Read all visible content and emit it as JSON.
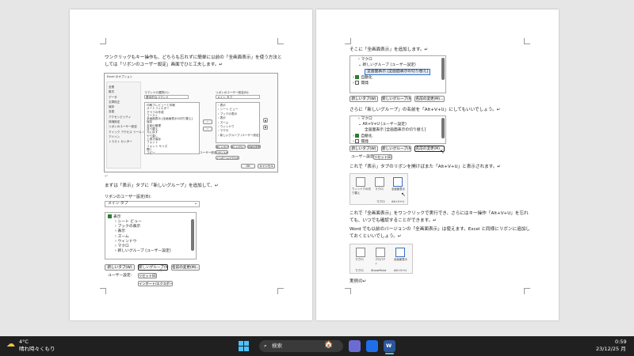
{
  "left_page": {
    "para1": "ワンクリックもキー操作も、どちらも忘れずに簡単に以前の「全画面表示」を使う方法と",
    "para1b": "しては「リボンのユーザー設定」画面でひと工夫します。↵",
    "dialog": {
      "title": "Excel のオプション",
      "categories": [
        "全般",
        "数式",
        "データ",
        "文章校正",
        "保存",
        "言語",
        "アクセシビリティ",
        "詳細設定",
        "リボンのユーザー設定",
        "クイック アクセス ツール バー",
        "アドイン",
        "トラスト センター"
      ],
      "commands_label": "コマンドの選択(C):",
      "commands_value": "基本的なコマンド",
      "ribbon_label": "リボンのユーザー設定(B):",
      "ribbon_value": "メイン タブ",
      "command_items": [
        "印刷プレビューと印刷",
        "オートフィルター",
        "グラフの作成",
        "ゴースト",
        "全画面表示 [全画面表示の切り替え]",
        "保存",
        "名前の管理",
        "並べ替え",
        "元に戻す",
        "やり直し",
        "上書き保存",
        "フォント",
        "フォント サイズ",
        "開く",
        "コピー"
      ],
      "tree_items": [
        "表示",
        "シート ビュー",
        "ブックの表示",
        "表示",
        "ズーム",
        "ウィンドウ",
        "マクロ",
        "新しいグループ (ユーザー設定)"
      ],
      "buttons": [
        "新しいタブ(W)",
        "新しいグループ(N)",
        "名前の変更(M)..."
      ],
      "reset_label": "ユーザー設定:",
      "reset_btn": "リセット(E)",
      "import_btn": "インポート/エクスポート(P)",
      "ok": "OK",
      "cancel": "キャンセル"
    },
    "para2": "まずは「表示」タブに「新しいグループ」を追加して、↵",
    "zoom": {
      "ribbon_label": "リボンのユーザー設定(B):",
      "ribbon_value": "メイン タブ",
      "tree_root": "表示",
      "tree_items": [
        "シート ビュー",
        "ブックの表示",
        "表示",
        "ズーム",
        "ウィンドウ",
        "マクロ",
        "新しいグループ (ユーザー設定)"
      ],
      "buttons": [
        "新しいタブ(W)",
        "新しいグループ(N)",
        "名前の変更(M)..."
      ],
      "reset_label": "ユーザー設定:",
      "reset_btn": "リセット(E) ▾",
      "import_btn": "インポート/エクスポート(P) ▾"
    }
  },
  "right_page": {
    "para1": "そこに「全画面表示」を追加します。↵",
    "panel1": {
      "items": [
        "マクロ",
        "新しいグループ (ユーザー設定)",
        "全画面表示 [全画面表示の切り替え]",
        "自動化",
        "開発"
      ],
      "buttons": [
        "新しいタブ(W)",
        "新しいグループ(N)",
        "名前の変更(M)..."
      ]
    },
    "para2": "さらに「新しいグループ」の名前を「Alt+V+U」にしてもいいでしょう。↵",
    "panel2": {
      "items": [
        "マクロ",
        "Alt+V+U (ユーザー設定)",
        "全画面表示 [全画面表示の切り替え]",
        "自動化",
        "開発"
      ],
      "buttons": [
        "新しいタブ(W)",
        "新しいグループ(N)",
        "名前の変更(M)..."
      ],
      "reset_label": "ユーザー設定:",
      "reset_btn": "リセット(E) ▾"
    },
    "para3": "これで「表示」タブのリボンを開けばまた「Alt+V+U」と表示されます。↵",
    "ribbon1": {
      "cmd1": "ウィンドウの切り替え",
      "cmd2": "マクロ",
      "cmd3": "全画面表示",
      "group1": "マクロ",
      "group2": "Alt+V+U"
    },
    "para4": "これで「全画面表示」をワンクリックで実行でき、さらにはキー操作「Alt+V+U」を忘れ",
    "para4b": "ても、いつでも確認することができます。↵",
    "para5": "Word でも以前のバージョンの「全画面表示」は使えます。Excel と同様にリボンに追加し",
    "para5b": "ておくといいでしょう。↵",
    "ribbon2": {
      "cmd1": "マクロ",
      "cmd2": "プロパティ",
      "cmd3": "全画面表示",
      "group1": "マクロ",
      "group2": "SharePoint",
      "group3": "Alt+V+U"
    },
    "para6": "実例の↵"
  },
  "taskbar": {
    "weather_temp": "4°C",
    "weather_desc": "晴れ時々くもり",
    "search_placeholder": "検索",
    "time": "0:59",
    "date": "23/12/25 月"
  }
}
